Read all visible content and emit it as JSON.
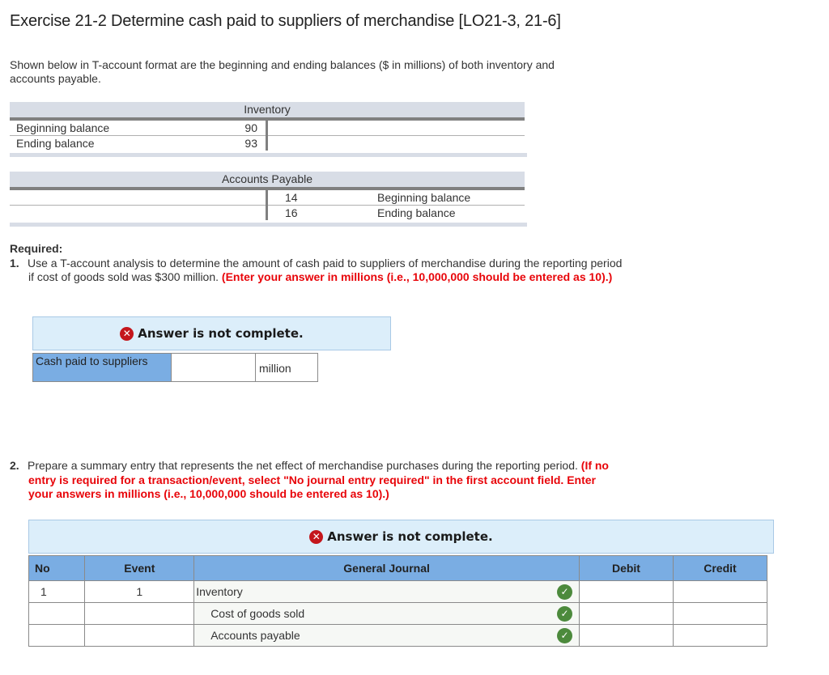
{
  "title": "Exercise 21-2 Determine cash paid to suppliers of merchandise [LO21-3, 21-6]",
  "intro": "Shown below in T-account format are the beginning and ending balances ($ in millions) of both inventory and accounts payable.",
  "inventory": {
    "title": "Inventory",
    "rows": [
      {
        "label": "Beginning balance",
        "value": "90"
      },
      {
        "label": "Ending balance",
        "value": "93"
      }
    ]
  },
  "accounts_payable": {
    "title": "Accounts Payable",
    "rows": [
      {
        "label": "Beginning balance",
        "value": "14"
      },
      {
        "label": "Ending balance",
        "value": "16"
      }
    ]
  },
  "required": {
    "heading": "Required:",
    "q1_num": "1.",
    "q1_text": "Use a T-account analysis to determine the amount of cash paid to suppliers of merchandise during the reporting period if cost of goods sold was $300 million.",
    "q1_note": "(Enter your answer in millions (i.e., 10,000,000 should be entered as 10).)",
    "q2_num": "2.",
    "q2_text": "Prepare a summary entry that represents the net effect of merchandise purchases during the reporting period.",
    "q2_note": "(If no entry is required for a transaction/event, select \"No journal entry required\" in the first account field. Enter your answers in millions (i.e., 10,000,000 should be entered as 10).)"
  },
  "part1": {
    "status": "Answer is not complete.",
    "label": "Cash paid to suppliers",
    "value": "",
    "unit": "million"
  },
  "part2": {
    "status": "Answer is not complete.",
    "headers": {
      "no": "No",
      "event": "Event",
      "journal": "General Journal",
      "debit": "Debit",
      "credit": "Credit"
    },
    "rows": [
      {
        "no": "1",
        "event": "1",
        "account": "Inventory",
        "debit": "",
        "credit": "",
        "correct": true
      },
      {
        "no": "",
        "event": "",
        "account": "Cost of goods sold",
        "debit": "",
        "credit": "",
        "correct": true
      },
      {
        "no": "",
        "event": "",
        "account": "Accounts payable",
        "debit": "",
        "credit": "",
        "correct": true
      }
    ]
  },
  "icons": {
    "error": "✕",
    "check": "✓"
  },
  "colors": {
    "header_blue": "#7aade3",
    "banner_bg": "#dceefa",
    "error_red": "#c4161c",
    "check_green": "#4c8a3c",
    "note_red": "#e8050a"
  }
}
